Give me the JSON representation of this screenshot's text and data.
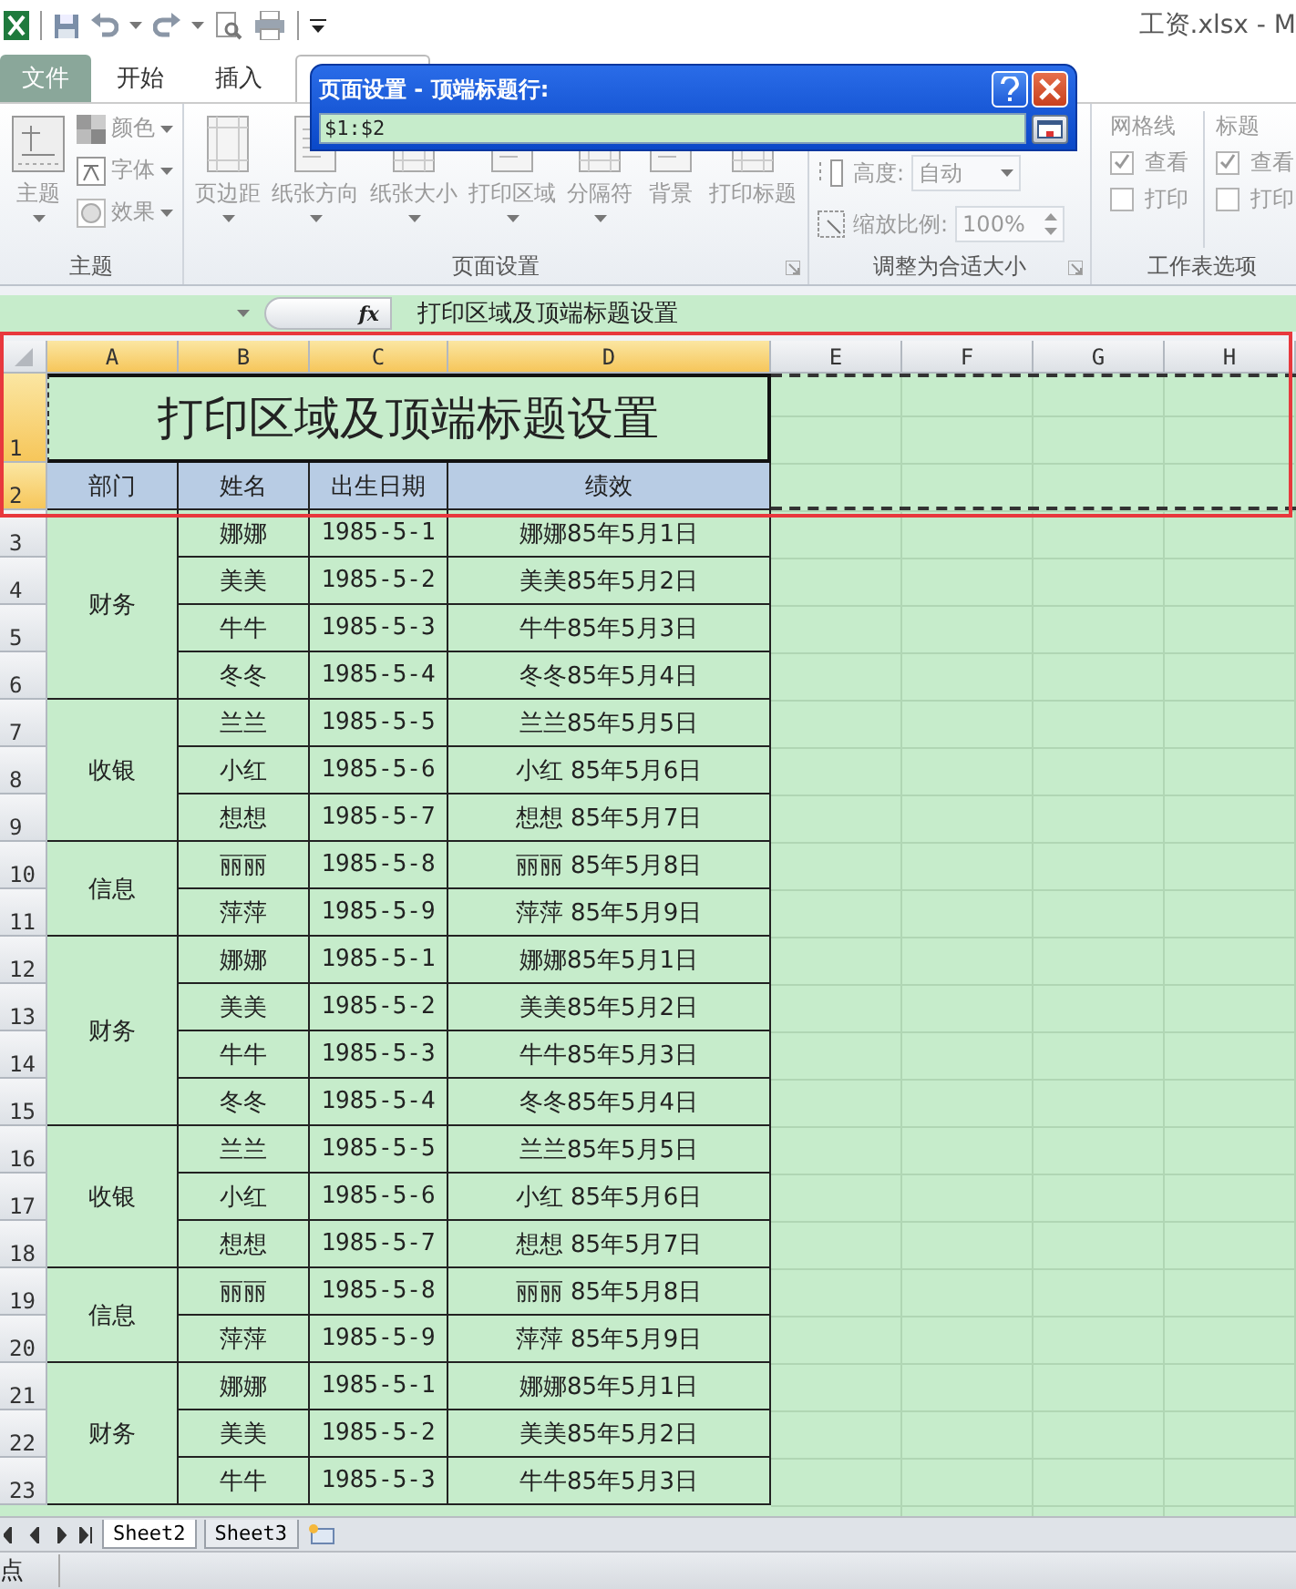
{
  "window": {
    "title": "工资.xlsx - M"
  },
  "ribbon": {
    "disabled": true,
    "tabs": [
      {
        "label": "文件",
        "kind": "file",
        "selected": false
      },
      {
        "label": "开始",
        "kind": "tab",
        "selected": false
      },
      {
        "label": "插入",
        "kind": "tab",
        "selected": false
      },
      {
        "kind": "covered",
        "selected": true
      }
    ],
    "groups": [
      {
        "kind": "theme",
        "label": "主题",
        "items": [
          {
            "kind": "large",
            "label": "主题"
          },
          {
            "kind": "small",
            "label": "颜色"
          },
          {
            "kind": "small",
            "label": "字体"
          },
          {
            "kind": "small",
            "label": "效果"
          }
        ]
      },
      {
        "kind": "page_setup",
        "label": "页面设置",
        "items": [
          {
            "label": "页边距",
            "kind": "menu"
          },
          {
            "label": "纸张方向",
            "kind": "menu"
          },
          {
            "label": "纸张大小",
            "kind": "menu"
          },
          {
            "label": "打印区域",
            "kind": "menu"
          },
          {
            "label": "分隔符",
            "kind": "menu"
          },
          {
            "label": "背景",
            "kind": "button"
          },
          {
            "label": "打印标题",
            "kind": "button"
          }
        ]
      },
      {
        "kind": "scale",
        "label": "调整为合适大小",
        "items": [
          {
            "kind": "dropdown",
            "label": "高度:",
            "value": "自动"
          },
          {
            "kind": "spinner",
            "label": "缩放比例:",
            "value": "100%"
          }
        ]
      },
      {
        "kind": "sheet_options",
        "label": "工作表选项",
        "columns": [
          {
            "label": "网格线",
            "options": [
              {
                "label": "查看",
                "checked": true
              },
              {
                "label": "打印",
                "checked": false
              }
            ]
          },
          {
            "label": "标题",
            "options": [
              {
                "label": "查看",
                "checked": true
              },
              {
                "label": "打印",
                "checked": false
              }
            ]
          }
        ]
      }
    ]
  },
  "dialog": {
    "title": "页面设置 - 顶端标题行:",
    "value": "$1:$2"
  },
  "formula_bar": {
    "function_label": "fx",
    "formula": "打印区域及顶端标题设置"
  },
  "sheet": {
    "columns": [
      {
        "label": "A",
        "selected": true
      },
      {
        "label": "B",
        "selected": true
      },
      {
        "label": "C",
        "selected": true
      },
      {
        "label": "D",
        "selected": true
      },
      {
        "label": "E",
        "selected": false
      },
      {
        "label": "F",
        "selected": false
      },
      {
        "label": "G",
        "selected": false
      },
      {
        "label": "H",
        "selected": false
      }
    ],
    "title_row": {
      "number": "1",
      "selected": true,
      "text": "打印区域及顶端标题设置",
      "active": true
    },
    "header_row": {
      "number": "2",
      "selected": true,
      "cells": [
        "部门",
        "姓名",
        "出生日期",
        "绩效"
      ]
    },
    "groups": [
      {
        "department": "财务",
        "rows": [
          {
            "number": "3",
            "selected": false,
            "name": "娜娜",
            "date": "1985-5-1",
            "result": "娜娜85年5月1日"
          },
          {
            "number": "4",
            "selected": false,
            "name": "美美",
            "date": "1985-5-2",
            "result": "美美85年5月2日"
          },
          {
            "number": "5",
            "selected": false,
            "name": "牛牛",
            "date": "1985-5-3",
            "result": "牛牛85年5月3日"
          },
          {
            "number": "6",
            "selected": false,
            "name": "冬冬",
            "date": "1985-5-4",
            "result": "冬冬85年5月4日"
          }
        ]
      },
      {
        "department": "收银",
        "rows": [
          {
            "number": "7",
            "selected": false,
            "name": "兰兰",
            "date": "1985-5-5",
            "result": "兰兰85年5月5日"
          },
          {
            "number": "8",
            "selected": false,
            "name": "小红",
            "date": "1985-5-6",
            "result": "小红 85年5月6日"
          },
          {
            "number": "9",
            "selected": false,
            "name": "想想",
            "date": "1985-5-7",
            "result": "想想 85年5月7日"
          }
        ]
      },
      {
        "department": "信息",
        "rows": [
          {
            "number": "10",
            "selected": false,
            "name": "丽丽",
            "date": "1985-5-8",
            "result": "丽丽 85年5月8日"
          },
          {
            "number": "11",
            "selected": false,
            "name": "萍萍",
            "date": "1985-5-9",
            "result": "萍萍 85年5月9日"
          }
        ]
      },
      {
        "department": "财务",
        "rows": [
          {
            "number": "12",
            "selected": false,
            "name": "娜娜",
            "date": "1985-5-1",
            "result": "娜娜85年5月1日"
          },
          {
            "number": "13",
            "selected": false,
            "name": "美美",
            "date": "1985-5-2",
            "result": "美美85年5月2日"
          },
          {
            "number": "14",
            "selected": false,
            "name": "牛牛",
            "date": "1985-5-3",
            "result": "牛牛85年5月3日"
          },
          {
            "number": "15",
            "selected": false,
            "name": "冬冬",
            "date": "1985-5-4",
            "result": "冬冬85年5月4日"
          }
        ]
      },
      {
        "department": "收银",
        "rows": [
          {
            "number": "16",
            "selected": false,
            "name": "兰兰",
            "date": "1985-5-5",
            "result": "兰兰85年5月5日"
          },
          {
            "number": "17",
            "selected": false,
            "name": "小红",
            "date": "1985-5-6",
            "result": "小红 85年5月6日"
          },
          {
            "number": "18",
            "selected": false,
            "name": "想想",
            "date": "1985-5-7",
            "result": "想想 85年5月7日"
          }
        ]
      },
      {
        "department": "信息",
        "rows": [
          {
            "number": "19",
            "selected": false,
            "name": "丽丽",
            "date": "1985-5-8",
            "result": "丽丽 85年5月8日"
          },
          {
            "number": "20",
            "selected": false,
            "name": "萍萍",
            "date": "1985-5-9",
            "result": "萍萍 85年5月9日"
          }
        ]
      },
      {
        "department": "财务",
        "rows": [
          {
            "number": "21",
            "selected": false,
            "name": "娜娜",
            "date": "1985-5-1",
            "result": "娜娜85年5月1日"
          },
          {
            "number": "22",
            "selected": false,
            "name": "美美",
            "date": "1985-5-2",
            "result": "美美85年5月2日"
          },
          {
            "number": "23",
            "selected": false,
            "name": "牛牛",
            "date": "1985-5-3",
            "result": "牛牛85年5月3日"
          }
        ]
      }
    ]
  },
  "sheet_tabs": [
    {
      "label": "Sheet2",
      "selected": true
    },
    {
      "label": "Sheet3",
      "selected": false
    }
  ],
  "status_bar": {
    "text": "点"
  }
}
